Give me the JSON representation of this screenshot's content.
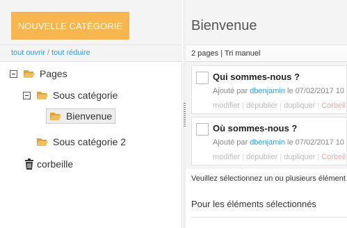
{
  "left": {
    "new_category_label": "NOUVELLE CATÉGORIE",
    "expand_all": "tout ouvrir",
    "separator": "/",
    "collapse_all": "tout réduire",
    "tree": {
      "root": "Pages",
      "sub1": "Sous catégorie",
      "selected": "Bienvenue",
      "sub2": "Sous catégorie 2",
      "trash": "corbeille"
    }
  },
  "right": {
    "title": "Bienvenue",
    "summary": "2 pages | Tri manuel",
    "pages": [
      {
        "title": "Qui sommes-nous ?",
        "added_by": "Ajouté par",
        "author": "dbenjamin",
        "date": "le 07/02/2017 10",
        "actions": [
          "modifier",
          "dépublier",
          "dupliquer"
        ],
        "danger_action": "Corbeil"
      },
      {
        "title": "Où sommes-nous ?",
        "added_by": "Ajouté par",
        "author": "dbenjamin",
        "date": "le 07/02/2017 10",
        "actions": [
          "modifier",
          "dépublier",
          "dupliquer"
        ],
        "danger_action": "Corbeil"
      }
    ],
    "selection_hint": "Veuillez sélectionnez un ou plusieurs élément",
    "bulk_label": "Pour les éléments sélectionnés"
  },
  "colors": {
    "accent": "#f8b650",
    "link": "#3a9fd6",
    "danger": "#e8a7a0"
  }
}
